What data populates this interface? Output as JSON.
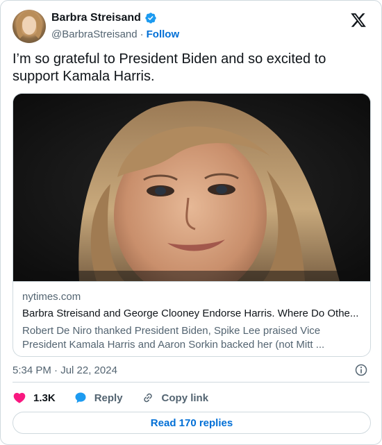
{
  "author": {
    "name": "Barbra Streisand",
    "handle": "@BarbraStreisand",
    "separator": "·",
    "follow_label": "Follow",
    "verified": true
  },
  "tweet": {
    "text": "I’m so grateful to President Biden and so excited to support Kamala Harris."
  },
  "link_card": {
    "domain": "nytimes.com",
    "title": "Barbra Streisand and George Clooney Endorse Harris. Where Do Othe...",
    "description": "Robert De Niro thanked President Biden, Spike Lee praised Vice President Kamala Harris and Aaron Sorkin backed her (not Mitt ..."
  },
  "meta": {
    "timestamp": "5:34 PM · Jul 22, 2024"
  },
  "actions": {
    "likes": "1.3K",
    "reply_label": "Reply",
    "copy_link_label": "Copy link"
  },
  "replies_button": {
    "label": "Read 170 replies"
  },
  "colors": {
    "accent": "#006fd6",
    "like": "#f91880",
    "reply_icon": "#1d9bf0",
    "verified": "#1d9bf0",
    "muted": "#536471",
    "border": "#cfd9de"
  },
  "icons": {
    "platform": "x-logo-icon",
    "verified": "verified-badge-icon",
    "info": "info-icon",
    "like": "heart-icon",
    "reply": "speech-bubble-icon",
    "copy_link": "link-icon"
  }
}
